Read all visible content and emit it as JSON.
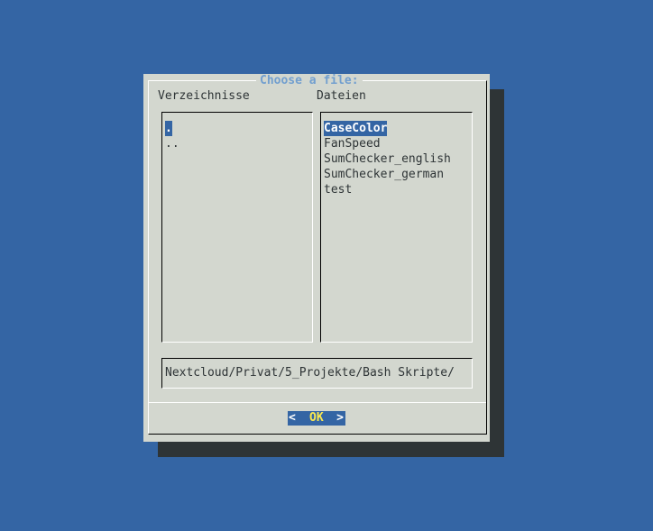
{
  "dialog": {
    "title": "Choose a file:",
    "directories_label": "Verzeichnisse",
    "files_label": "Dateien",
    "directories": [
      ".",
      ".."
    ],
    "files": [
      "CaseColor",
      "FanSpeed",
      "SumChecker_english",
      "SumChecker_german",
      "test"
    ],
    "selected_directory": ".",
    "selected_file": "CaseColor",
    "path": "Nextcloud/Privat/5_Projekte/Bash Skripte/",
    "ok_button": {
      "left": "<",
      "label": "OK",
      "right": ">"
    }
  },
  "colors": {
    "desktop": "#3465a4",
    "dialog": "#d3d7cf",
    "shadow": "#2e3436",
    "title": "#729fcf",
    "selection": "#3465a4",
    "ok_hotkey": "#fce94f"
  }
}
